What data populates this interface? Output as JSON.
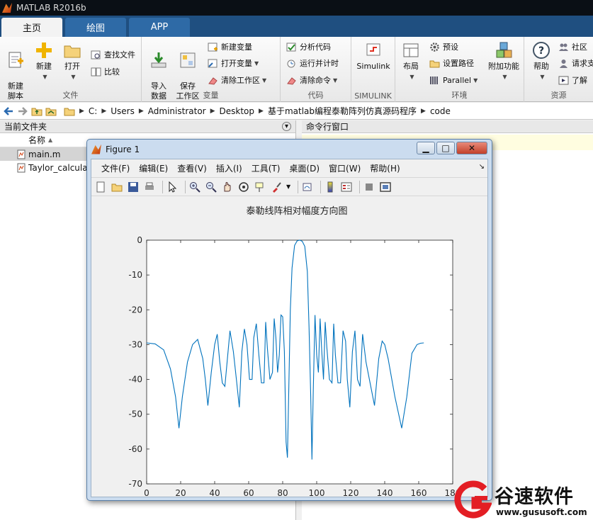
{
  "app": {
    "title": "MATLAB R2016b"
  },
  "tabs": [
    {
      "label": "主页"
    },
    {
      "label": "绘图"
    },
    {
      "label": "APP"
    }
  ],
  "ribbon": {
    "file": {
      "section_label": "文件",
      "new_script": "新建\n脚本",
      "new": "新建",
      "open": "打开",
      "find_files": "查找文件",
      "compare": "比较"
    },
    "variable": {
      "section_label": "变量",
      "import_data": "导入\n数据",
      "save_workspace": "保存\n工作区",
      "new_variable": "新建变量",
      "open_variable": "打开变量",
      "clear_workspace": "清除工作区"
    },
    "code": {
      "section_label": "代码",
      "analyze_code": "分析代码",
      "run_and_time": "运行并计时",
      "clear_commands": "清除命令"
    },
    "simulink": {
      "section_label": "SIMULINK",
      "simulink": "Simulink"
    },
    "environment": {
      "section_label": "环境",
      "layout": "布局",
      "preferences": "预设",
      "set_path": "设置路径",
      "parallel": "Parallel",
      "addons": "附加功能"
    },
    "resources": {
      "section_label": "资源",
      "help": "帮助",
      "community": "社区",
      "request_support": "请求支",
      "learn": "了解"
    }
  },
  "address": {
    "crumbs": [
      "C:",
      "Users",
      "Administrator",
      "Desktop",
      "基于matlab编程泰勒阵列仿真源码程序",
      "code"
    ]
  },
  "current_folder": {
    "title": "当前文件夹",
    "column_name": "名称",
    "files": [
      {
        "name": "main.m"
      },
      {
        "name": "Taylor_calcula"
      }
    ]
  },
  "command_window": {
    "title": "命令行窗口"
  },
  "figure": {
    "title": "Figure 1",
    "menus": [
      "文件(F)",
      "编辑(E)",
      "查看(V)",
      "插入(I)",
      "工具(T)",
      "桌面(D)",
      "窗口(W)",
      "帮助(H)"
    ]
  },
  "chart_data": {
    "type": "line",
    "title": "泰勒线阵相对幅度方向图",
    "xlabel": "",
    "ylabel": "",
    "xlim": [
      0,
      180
    ],
    "ylim": [
      -70,
      0
    ],
    "xticks": [
      0,
      20,
      40,
      60,
      80,
      100,
      120,
      140,
      160,
      180
    ],
    "yticks": [
      0,
      -10,
      -20,
      -30,
      -40,
      -50,
      -60,
      -70
    ],
    "grid": false,
    "series_color": "#0072bd",
    "x": [
      0,
      5,
      10,
      14,
      17,
      19,
      21,
      24,
      27,
      30,
      33,
      34.5,
      36,
      38,
      40,
      41.5,
      43,
      44.5,
      46,
      49,
      51,
      53,
      54.5,
      56,
      57.5,
      59,
      60.5,
      62,
      63,
      64.5,
      66,
      67.5,
      69,
      70,
      71,
      72.5,
      74,
      75,
      76,
      77,
      78,
      79,
      80,
      81,
      82,
      82.8,
      83.5,
      84.5,
      85.5,
      87,
      88.5,
      90,
      91.5,
      93,
      94.5,
      95.5,
      96.5,
      97.2,
      98,
      99,
      100,
      101,
      102,
      103,
      104,
      105,
      106,
      107.5,
      109,
      110,
      111,
      112.5,
      114,
      115.5,
      117,
      118,
      119.5,
      121,
      122.5,
      124,
      125.5,
      127,
      129,
      131,
      134,
      136.5,
      138.5,
      140,
      142,
      146,
      150,
      153,
      156,
      159,
      161,
      163,
      166,
      170,
      175,
      180
    ],
    "y": [
      -29.5,
      -29.8,
      -31.5,
      -37,
      -45,
      -54,
      -45,
      -35,
      -30,
      -28.5,
      -34,
      -40,
      -47.5,
      -38,
      -30,
      -27,
      -35,
      -41,
      -42,
      -26,
      -32,
      -41,
      -48,
      -32,
      -25.5,
      -30,
      -40,
      -40,
      -28,
      -24,
      -33,
      -41,
      -41,
      -23.5,
      -31,
      -40,
      -38,
      -22.5,
      -28,
      -38,
      -33,
      -21.5,
      -22,
      -32,
      -58,
      -62.5,
      -45,
      -20,
      -8,
      -1.5,
      -0.2,
      0,
      -0.3,
      -1.8,
      -9,
      -25,
      -45,
      -63,
      -43,
      -21.5,
      -33,
      -38,
      -22.5,
      -32,
      -40,
      -23.5,
      -31,
      -40,
      -41,
      -24,
      -33,
      -41,
      -41,
      -26,
      -29,
      -40,
      -48,
      -32,
      -26,
      -40,
      -42,
      -27,
      -35,
      -40,
      -47.5,
      -34,
      -29,
      -30,
      -34,
      -45,
      -54,
      -45,
      -32.5,
      -30,
      -29.6,
      -29.5
    ]
  },
  "watermark": {
    "name": "谷速软件",
    "url": "www.gususoft.com"
  }
}
